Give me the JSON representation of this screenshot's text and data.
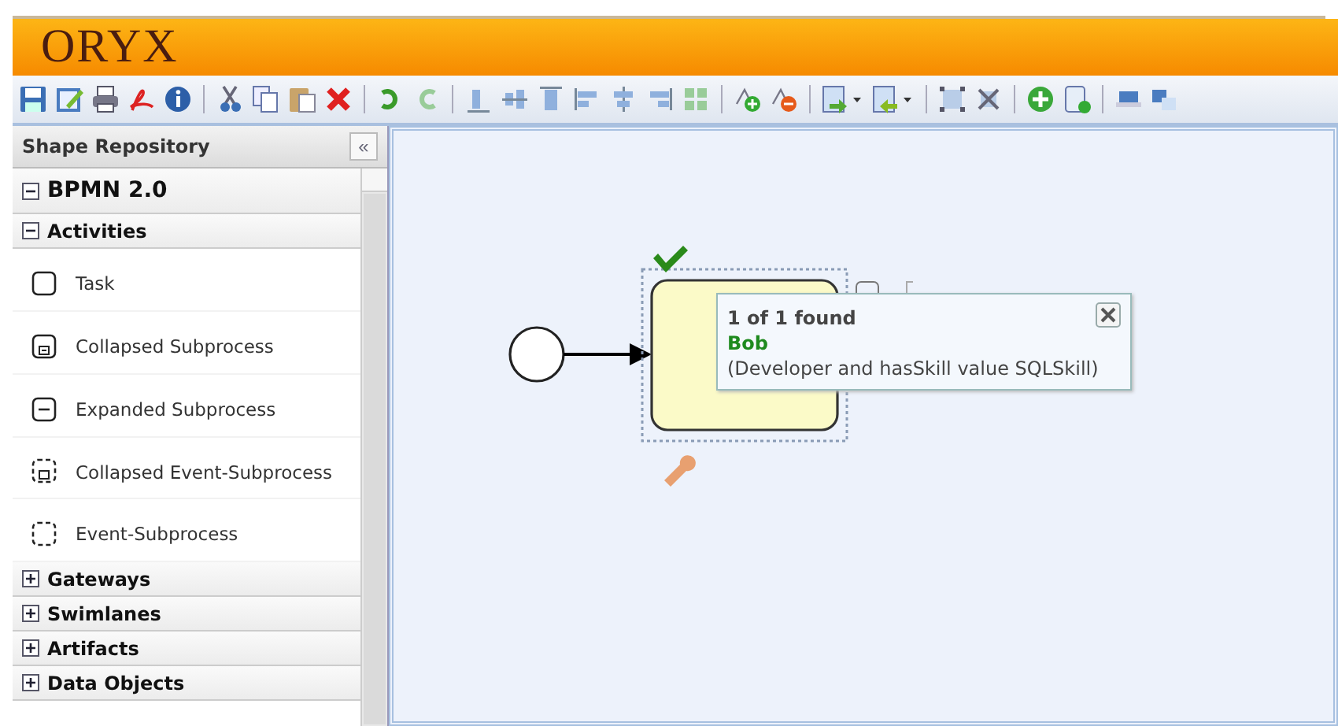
{
  "header": {
    "logo": "ORYX"
  },
  "shape_repository": {
    "title": "Shape Repository",
    "collapse": "«",
    "tree": [
      {
        "label": "BPMN 2.0",
        "expanded": true,
        "children": [
          {
            "label": "Activities",
            "expanded": true,
            "items": [
              {
                "label": "Task",
                "kind": "task"
              },
              {
                "label": "Collapsed Subprocess",
                "kind": "collapsed"
              },
              {
                "label": "Expanded Subprocess",
                "kind": "expanded"
              },
              {
                "label": "Collapsed Event-Subprocess",
                "kind": "collapsed-event"
              },
              {
                "label": "Event-Subprocess",
                "kind": "event"
              }
            ]
          },
          {
            "label": "Gateways",
            "expanded": false
          },
          {
            "label": "Swimlanes",
            "expanded": false
          },
          {
            "label": "Artifacts",
            "expanded": false
          },
          {
            "label": "Data Objects",
            "expanded": false
          }
        ]
      }
    ]
  },
  "search_popup": {
    "count": "1 of 1 found",
    "name": "Bob",
    "detail": "(Developer and hasSkill value SQLSkill)"
  }
}
